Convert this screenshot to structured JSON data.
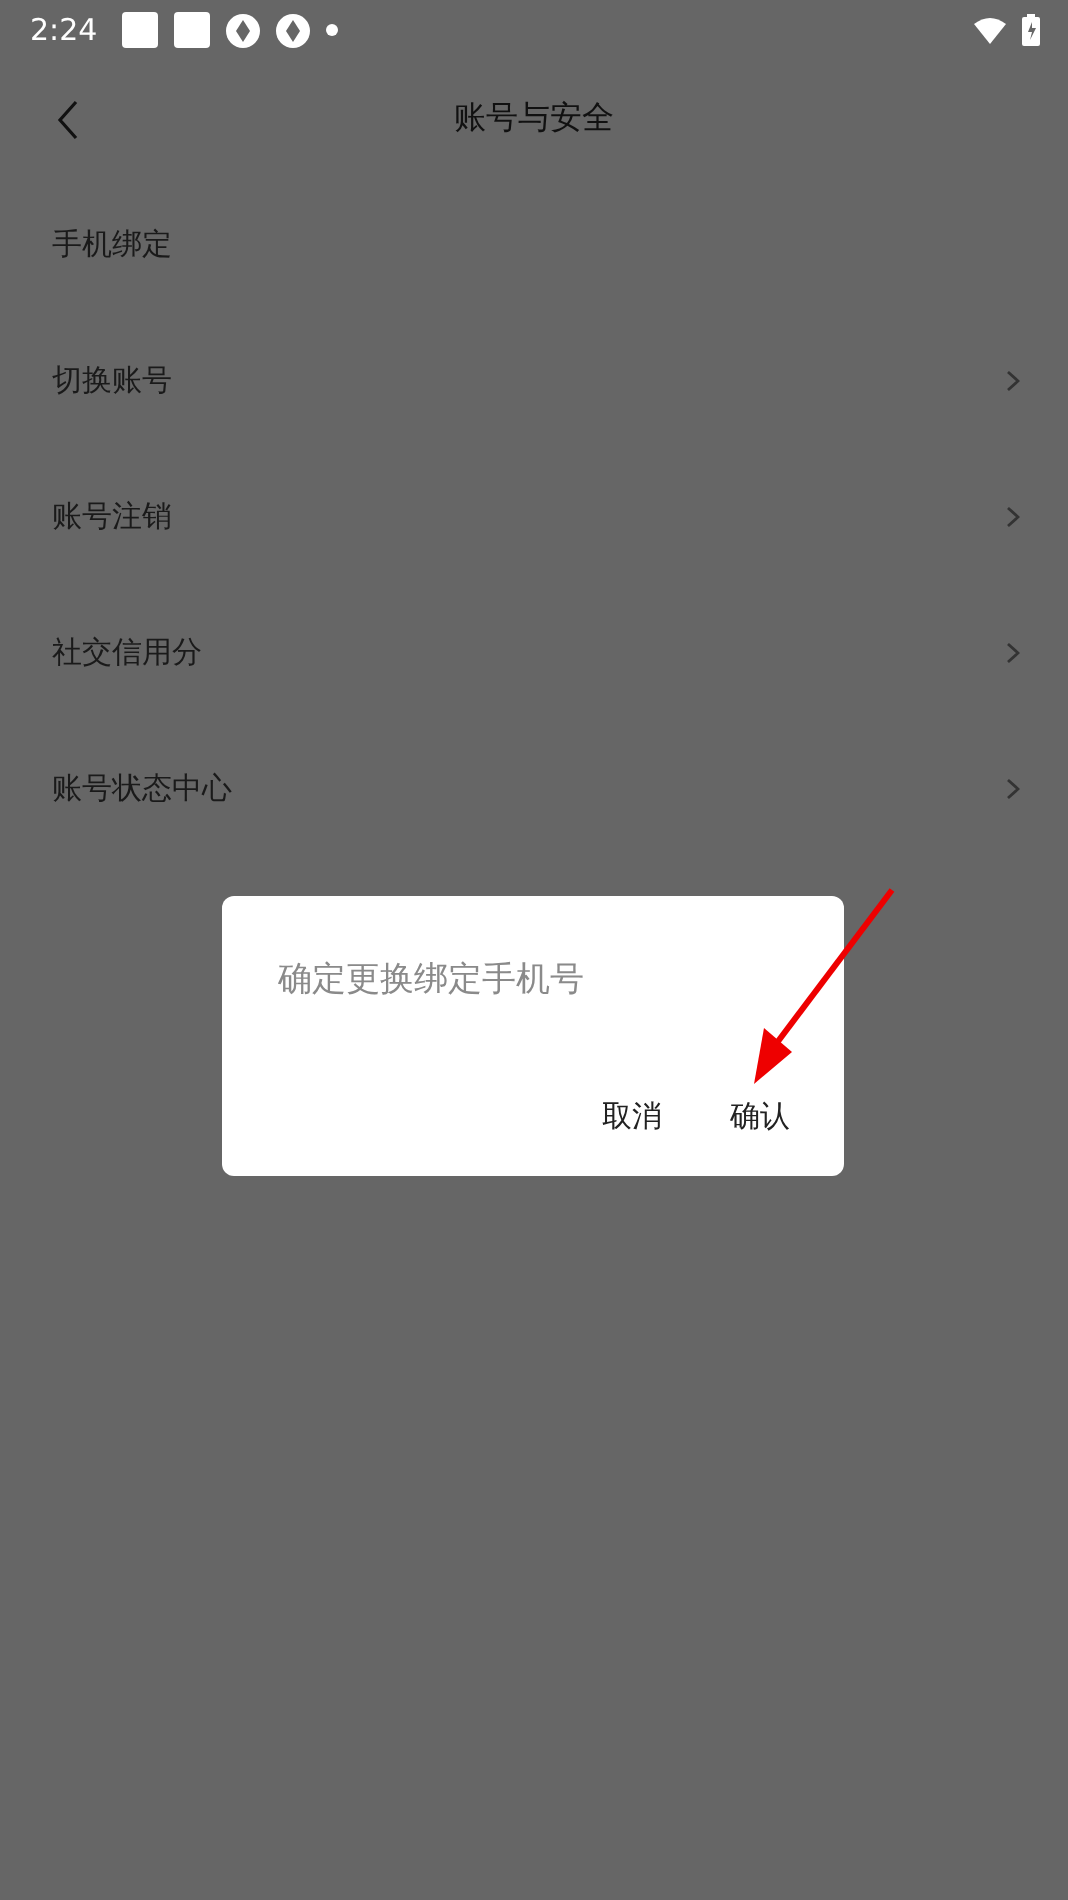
{
  "status_bar": {
    "time": "2:24"
  },
  "header": {
    "title": "账号与安全"
  },
  "menu": [
    {
      "label": "手机绑定",
      "chevron": false
    },
    {
      "label": "切换账号",
      "chevron": true
    },
    {
      "label": "账号注销",
      "chevron": true
    },
    {
      "label": "社交信用分",
      "chevron": true
    },
    {
      "label": "账号状态中心",
      "chevron": true
    }
  ],
  "dialog": {
    "message": "确定更换绑定手机号",
    "buttons": [
      "取消",
      "确认"
    ]
  }
}
